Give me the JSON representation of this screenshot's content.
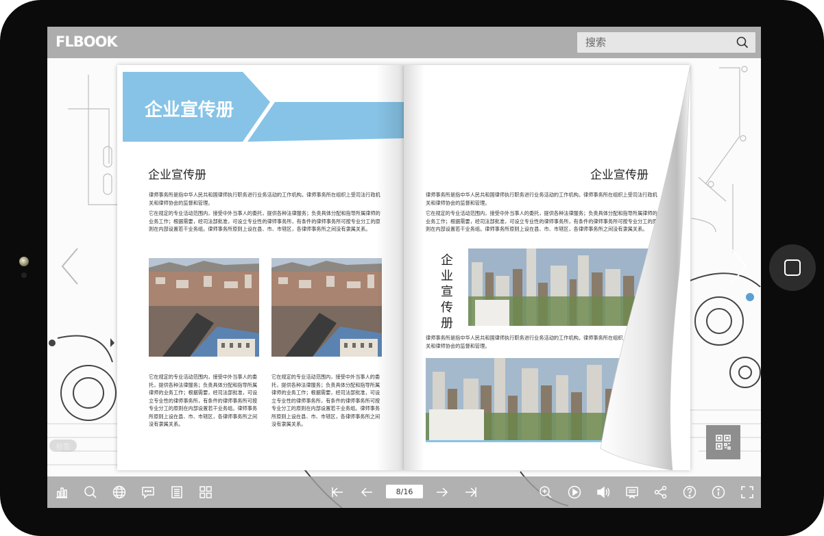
{
  "app": {
    "logo_text": "FLBOOK"
  },
  "search": {
    "placeholder": "搜索"
  },
  "book": {
    "left_page": {
      "banner_title": "企业宣传册",
      "heading": "企业宣传册",
      "intro_para_1": "律师事务所是指中华人民共和国律师执行职务进行业务活动的工作机构。律师事务所在组织上受司法行政机关和律师协会的监督和管理。",
      "intro_para_2": "它在规定的专业活动范围内，接受中外当事人的委托，提供各种法律服务；负责具体分配和指导所属律师的业务工作；根据需要，经司法部批准，可设立专业性的律师事务所，有条件的律师事务所可按专业分工的原则在内部设置若干业务组。律师事务所原则上设在县、市、市辖区，各律师事务所之间没有隶属关系。",
      "col_para_1": "它在规定的专业活动范围内，接受中外当事人的委托，提供各种法律服务；负责具体分配和指导所属律师的业务工作；根据需要，经司法部批准，可设立专业性的律师事务所，有条件的律师事务所可按专业分工的原则在内部设置若干业务组。律师事务所原则上设在县、市、市辖区，各律师事务所之间没有隶属关系。",
      "col_para_2": "它在规定的专业活动范围内，接受中外当事人的委托，提供各种法律服务；负责具体分配和指导所属律师的业务工作；根据需要，经司法部批准，可设立专业性的律师事务所，有条件的律师事务所可按专业分工的原则在内部设置若干业务组。律师事务所原则上设在县、市、市辖区，各律师事务所之间没有隶属关系。"
    },
    "right_page": {
      "heading": "企业宣传册",
      "intro_para_1": "律师事务所是指中华人民共和国律师执行职务进行业务活动的工作机构。律师事务所在组织上受司法行政机关和律师协会的监督和管理。",
      "intro_para_2": "它在规定的专业活动范围内，接受中外当事人的委托，提供各种法律服务；负责具体分配和指导所属律师的业务工作；根据需要，经司法部批准，可设立专业性的律师事务所，有条件的律师事务所可按专业分工的原则在内部设置若干业务组。律师事务所原则上设在县、市、市辖区，各律师事务所之间没有隶属关系。",
      "vertical_title": "企业宣传册",
      "mid_para": "律师事务所是指中华人民共和国律师执行职务进行业务活动的工作机构。律师事务所在组织上受司法行政机关和律师协会的监督和管理。"
    }
  },
  "toolbar": {
    "page_indicator": "8/16",
    "tag_label": "标签"
  },
  "colors": {
    "accent": "#87c3e6",
    "topbar": "#adadad",
    "bottombar": "#a0a0a0"
  },
  "icons": [
    "chart-icon",
    "search-icon",
    "globe-icon",
    "comment-icon",
    "list-icon",
    "grid-icon",
    "first-page-icon",
    "prev-page-icon",
    "next-page-icon",
    "last-page-icon",
    "zoom-in-icon",
    "play-icon",
    "volume-icon",
    "bookmark-icon",
    "share-icon",
    "help-icon",
    "info-icon",
    "fullscreen-icon",
    "qr-code-icon"
  ]
}
